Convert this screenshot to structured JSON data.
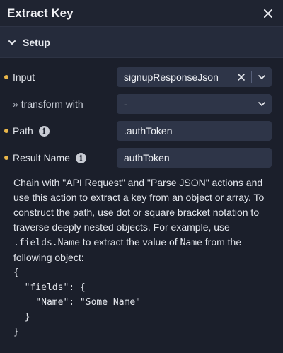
{
  "window": {
    "title": "Extract Key"
  },
  "section": {
    "title": "Setup"
  },
  "fields": {
    "input": {
      "label": "Input",
      "value": "signupResponseJson"
    },
    "transform": {
      "label": "transform with",
      "prefix": "»",
      "value": "-"
    },
    "path": {
      "label": "Path",
      "value": ".authToken"
    },
    "result_name": {
      "label": "Result Name",
      "value": "authToken"
    }
  },
  "description": {
    "part1": "Chain with \"API Request\" and \"Parse JSON\" actions and use this action to extract a key from an object or array. To construct the path, use dot or square bracket notation to traverse deeply nested objects. For example, use ",
    "code_path": ".fields.Name",
    "part2": " to extract the value of ",
    "code_key": "Name",
    "part3": " from the following object:",
    "code_block": "{\n  \"fields\": {\n    \"Name\": \"Some Name\"\n  }\n}"
  },
  "colors": {
    "required_dot": "#e9b64a",
    "background": "#1b1f2b",
    "field_bg": "#2e3548"
  },
  "icons": {
    "close": "close-icon",
    "collapse": "chevron-down-icon",
    "info": "info-icon",
    "clear": "clear-icon",
    "dropdown": "chevron-down-icon"
  }
}
